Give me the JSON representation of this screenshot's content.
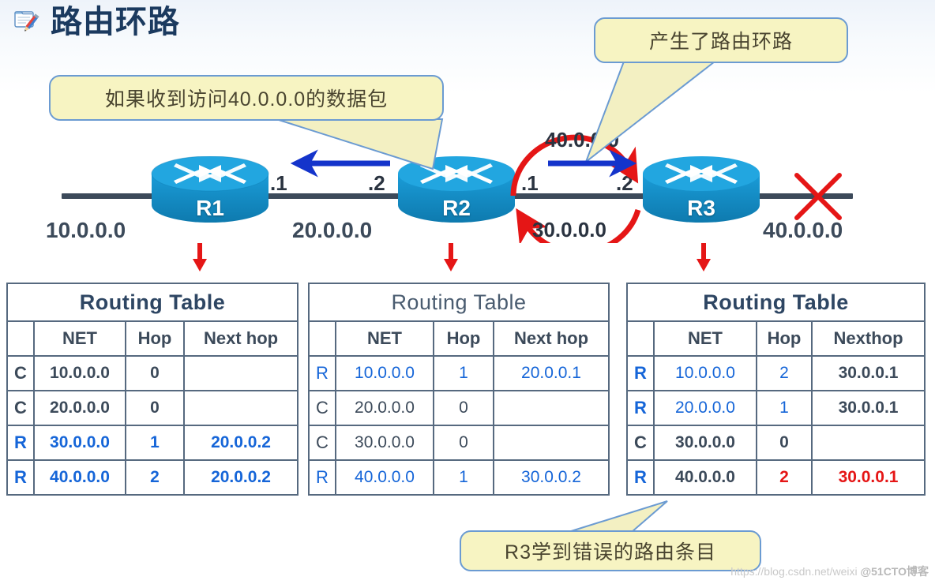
{
  "slide": {
    "title": "路由环路",
    "title_icon": "document-edit-icon",
    "background_color": "#ffffff"
  },
  "callouts": {
    "left": "如果收到访问40.0.0.0的数据包",
    "right": "产生了路由环路",
    "bottom": "R3学到错误的路由条目",
    "fill_color": "#f7f4c2",
    "border_color": "#6b9bd2"
  },
  "topology": {
    "routers": [
      {
        "name": "R1"
      },
      {
        "name": "R2"
      },
      {
        "name": "R3"
      }
    ],
    "networks": {
      "left": "10.0.0.0",
      "middle": "20.0.0.0",
      "right": "40.0.0.0"
    },
    "interfaces": {
      "r1_right": ".1",
      "r2_left": ".2",
      "r2_right": ".1",
      "r3_left": ".2"
    },
    "loop_labels": {
      "top": "40.0.0.0",
      "bottom": "30.0.0.0"
    },
    "link_down_marker": "red-x",
    "loop_color": "#e51616",
    "packet_arrow_color": "#1434cb"
  },
  "tables": [
    {
      "id": "r1",
      "caption": "Routing Table",
      "headers": [
        "",
        "NET",
        "Hop",
        "Next hop"
      ],
      "rows": [
        {
          "code": "C",
          "net": "10.0.0.0",
          "hop": "0",
          "nexthop": "",
          "style": "dark"
        },
        {
          "code": "C",
          "net": "20.0.0.0",
          "hop": "0",
          "nexthop": "",
          "style": "dark"
        },
        {
          "code": "R",
          "net": "30.0.0.0",
          "hop": "1",
          "nexthop": "20.0.0.2",
          "style": "blue"
        },
        {
          "code": "R",
          "net": "40.0.0.0",
          "hop": "2",
          "nexthop": "20.0.0.2",
          "style": "blue"
        }
      ]
    },
    {
      "id": "r2",
      "caption": "Routing Table",
      "headers": [
        "",
        "NET",
        "Hop",
        "Next hop"
      ],
      "rows": [
        {
          "code": "R",
          "net": "10.0.0.0",
          "hop": "1",
          "nexthop": "20.0.0.1",
          "style": "blue"
        },
        {
          "code": "C",
          "net": "20.0.0.0",
          "hop": "0",
          "nexthop": "",
          "style": "dark"
        },
        {
          "code": "C",
          "net": "30.0.0.0",
          "hop": "0",
          "nexthop": "",
          "style": "dark"
        },
        {
          "code": "R",
          "net": "40.0.0.0",
          "hop": "1",
          "nexthop": "30.0.0.2",
          "style": "blue"
        }
      ]
    },
    {
      "id": "r3",
      "caption": "Routing Table",
      "headers": [
        "",
        "NET",
        "Hop",
        "Nexthop"
      ],
      "rows": [
        {
          "code": "R",
          "net": "10.0.0.0",
          "hop": "2",
          "nexthop": "30.0.0.1",
          "style": "mixed-blue"
        },
        {
          "code": "R",
          "net": "20.0.0.0",
          "hop": "1",
          "nexthop": "30.0.0.1",
          "style": "mixed-blue"
        },
        {
          "code": "C",
          "net": "30.0.0.0",
          "hop": "0",
          "nexthop": "",
          "style": "dark"
        },
        {
          "code": "R",
          "net": "40.0.0.0",
          "hop": "2",
          "nexthop": "30.0.0.1",
          "style": "error-red"
        }
      ]
    }
  ],
  "watermark": {
    "url": "https://blog.csdn.net/weixi",
    "site": "@51CTO博客"
  }
}
